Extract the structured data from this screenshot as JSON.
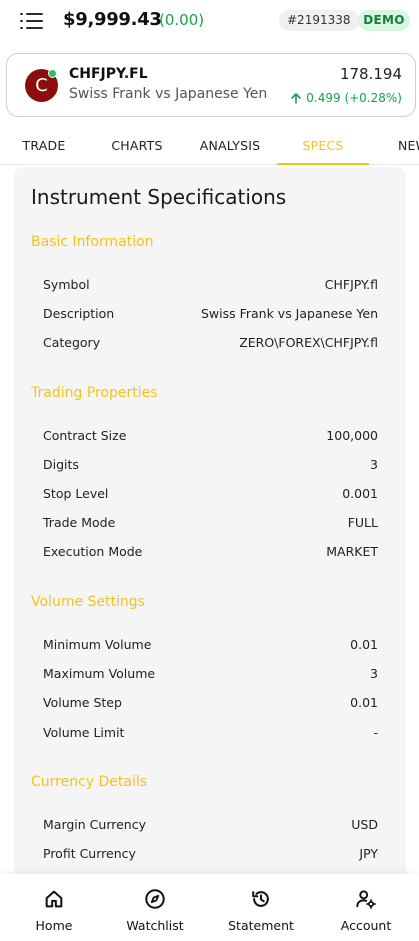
{
  "header": {
    "balance": "$9,999.43",
    "balance_change": "(0.00)",
    "account_id": "#2191338",
    "mode_badge": "DEMO"
  },
  "instrument": {
    "avatar_letter": "C",
    "symbol": "CHFJPY.FL",
    "name": "Swiss Frank vs Japanese Yen",
    "price": "178.194",
    "change": "0.499 (+0.28%)"
  },
  "tabs": [
    {
      "label": "TRADE",
      "active": false
    },
    {
      "label": "CHARTS",
      "active": false
    },
    {
      "label": "ANALYSIS",
      "active": false
    },
    {
      "label": "SPECS",
      "active": true
    },
    {
      "label": "NEW",
      "active": false
    }
  ],
  "specs": {
    "title": "Instrument Specifications",
    "sections": [
      {
        "title": "Basic Information",
        "rows": [
          {
            "key": "Symbol",
            "value": "CHFJPY.fl"
          },
          {
            "key": "Description",
            "value": "Swiss Frank vs Japanese Yen"
          },
          {
            "key": "Category",
            "value": "ZERO\\FOREX\\CHFJPY.fl"
          }
        ]
      },
      {
        "title": "Trading Properties",
        "rows": [
          {
            "key": "Contract Size",
            "value": "100,000"
          },
          {
            "key": "Digits",
            "value": "3"
          },
          {
            "key": "Stop Level",
            "value": "0.001"
          },
          {
            "key": "Trade Mode",
            "value": "FULL"
          },
          {
            "key": "Execution Mode",
            "value": "MARKET"
          }
        ]
      },
      {
        "title": "Volume Settings",
        "rows": [
          {
            "key": "Minimum Volume",
            "value": "0.01"
          },
          {
            "key": "Maximum Volume",
            "value": "3"
          },
          {
            "key": "Volume Step",
            "value": "0.01"
          },
          {
            "key": "Volume Limit",
            "value": "-"
          }
        ]
      },
      {
        "title": "Currency Details",
        "rows": [
          {
            "key": "Margin Currency",
            "value": "USD"
          },
          {
            "key": "Profit Currency",
            "value": "JPY"
          }
        ]
      }
    ]
  },
  "bottom_nav": [
    {
      "label": "Home",
      "icon": "home-icon"
    },
    {
      "label": "Watchlist",
      "icon": "compass-icon"
    },
    {
      "label": "Statement",
      "icon": "history-icon"
    },
    {
      "label": "Account",
      "icon": "user-settings-icon"
    }
  ],
  "colors": {
    "accent": "#f5c21b",
    "positive": "#16a34a",
    "avatar": "#8b0d0d",
    "demo_bg": "#d7f5e1"
  }
}
